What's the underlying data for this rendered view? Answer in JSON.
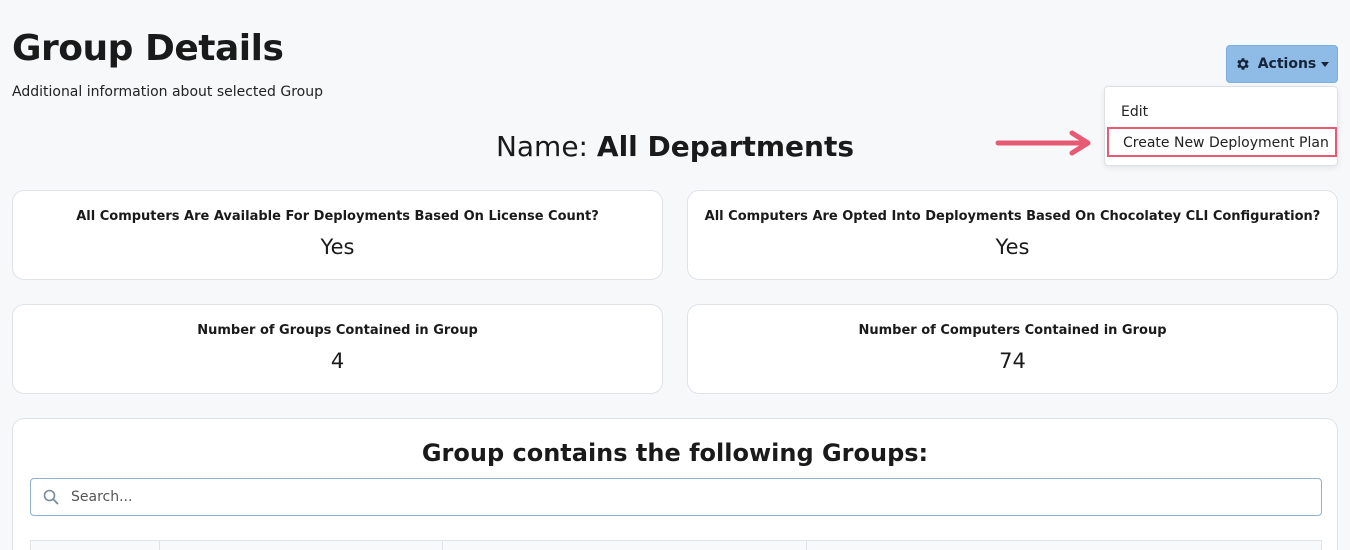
{
  "header": {
    "title": "Group Details",
    "subtitle": "Additional information about selected Group"
  },
  "actions": {
    "button_label": "Actions",
    "icon": "gear-icon",
    "menu": {
      "edit_label": "Edit",
      "create_plan_label": "Create New Deployment Plan"
    }
  },
  "group": {
    "name_prefix": "Name:",
    "name": "All Departments"
  },
  "cards": {
    "license": {
      "label": "All Computers Are Available For Deployments Based On License Count?",
      "value": "Yes"
    },
    "opted_in": {
      "label": "All Computers Are Opted Into Deployments Based On Chocolatey CLI Configuration?",
      "value": "Yes"
    },
    "groups_count": {
      "label": "Number of Groups Contained in Group",
      "value": "4"
    },
    "computers_count": {
      "label": "Number of Computers Contained in Group",
      "value": "74"
    }
  },
  "groups_panel": {
    "title": "Group contains the following Groups:",
    "search_placeholder": "Search..."
  },
  "colors": {
    "accent_button": "#8fbce6",
    "highlight": "#e75a74",
    "background": "#f7f8fa"
  }
}
